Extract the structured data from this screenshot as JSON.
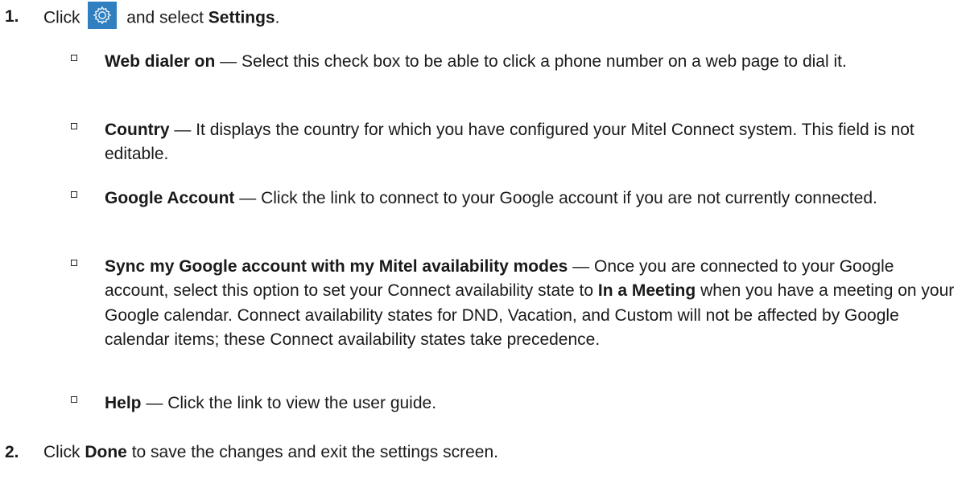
{
  "steps": [
    {
      "number": "1.",
      "prefix": "Click",
      "icon": "gear-icon",
      "middle": "and select",
      "bold": "Settings",
      "suffix": "."
    },
    {
      "number": "2.",
      "prefix": "Click",
      "bold": "Done",
      "suffix": "to save the changes and exit the settings screen."
    }
  ],
  "bullets": [
    {
      "term": "Web dialer on",
      "dash": "—",
      "text": "Select this check box to be able to click a phone number on a web page to dial it."
    },
    {
      "term": "Country",
      "dash": "—",
      "text": "It displays the country for which you have configured your Mitel Connect system. This field is not editable."
    },
    {
      "term": "Google Account",
      "dash": "—",
      "text": "Click the link to connect to your Google account if you are not currently connected."
    },
    {
      "term": "Sync my Google account with my Mitel availability modes",
      "dash": "—",
      "text_before": "Once you are connected to your Google account, select this option to set your Connect availability state to",
      "text_bold": "In a Meeting",
      "text_after": "when you have a meeting on your Google calendar. Connect availability states for DND, Vacation, and Custom will not be affected by Google calendar items; these Connect availability states take precedence."
    },
    {
      "term": "Help",
      "dash": "—",
      "text": "Click the link to view the user guide."
    }
  ],
  "colors": {
    "icon_background": "#2f7fc1",
    "text": "#1a1a1a"
  }
}
